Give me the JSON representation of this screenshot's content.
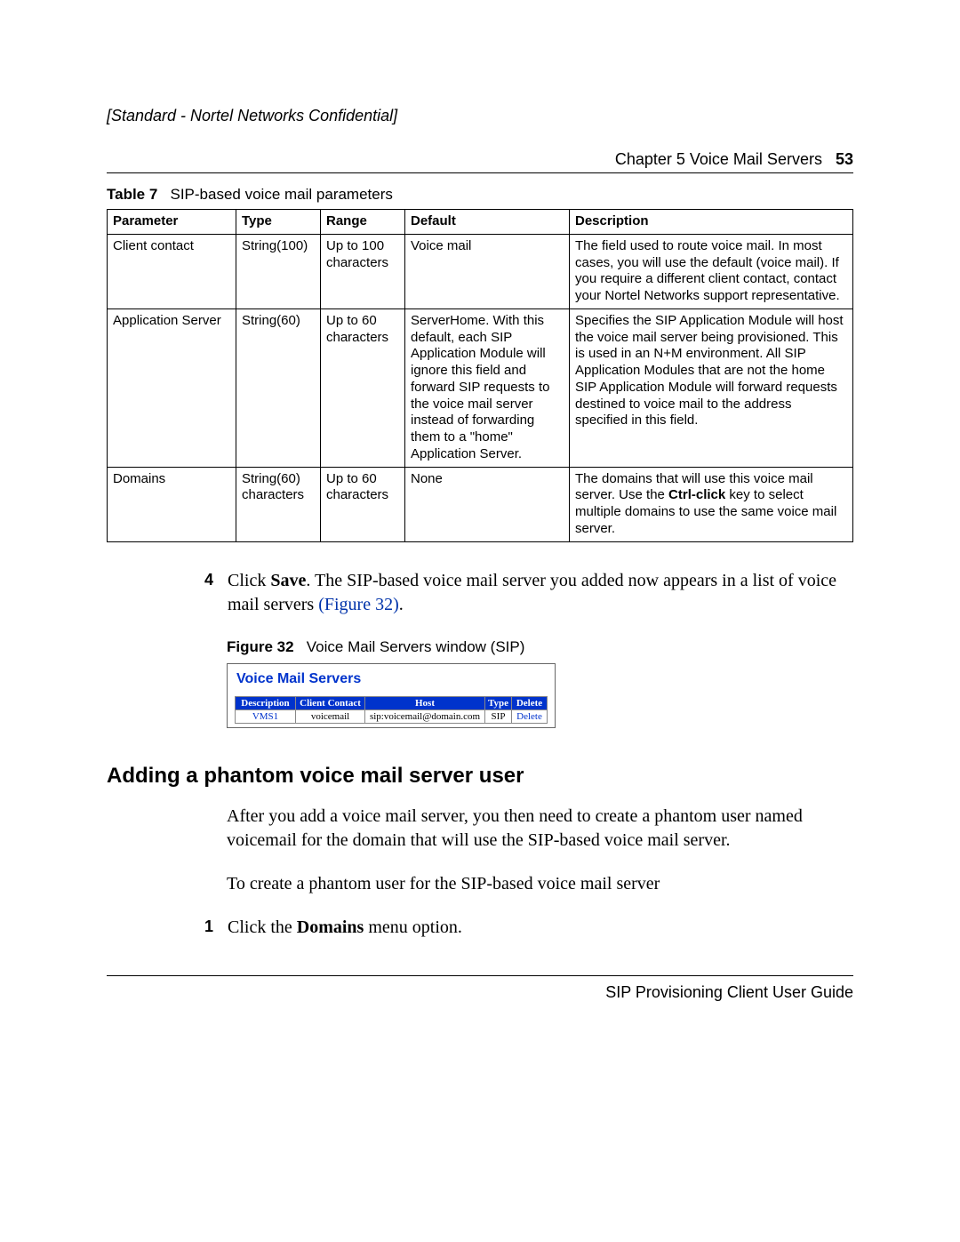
{
  "header": {
    "confidential": "[Standard - Nortel Networks Confidential]",
    "chapter": "Chapter 5  Voice Mail Servers",
    "page_number": "53"
  },
  "table7": {
    "label": "Table 7",
    "caption": "SIP-based voice mail parameters",
    "headers": {
      "parameter": "Parameter",
      "type": "Type",
      "range": "Range",
      "default": "Default",
      "description": "Description"
    },
    "rows": [
      {
        "parameter": "Client contact",
        "type": "String(100)",
        "range": "Up to 100 characters",
        "default": "Voice mail",
        "description": "The field used to route voice mail. In most cases, you will use the default (voice mail). If you require a different client contact, contact your Nortel Networks support representative."
      },
      {
        "parameter": "Application Server",
        "type": "String(60)",
        "range": "Up to 60 characters",
        "default": "ServerHome. With this default, each SIP Application Module will ignore this field and forward SIP requests to the voice mail server instead of forwarding them to a \"home\" Application Server.",
        "description": "Specifies the SIP Application Module will host the voice mail server being provisioned. This is used in an N+M environment. All SIP Application Modules that are not the home SIP Application Module will forward requests destined to voice mail to the address specified in this field."
      },
      {
        "parameter": "Domains",
        "type": "String(60) characters",
        "range": "Up to 60 characters",
        "default": "None",
        "desc_pre": "The domains that will use this voice mail server. Use the ",
        "desc_bold": "Ctrl-click",
        "desc_post": " key to select multiple domains to use the same voice mail server."
      }
    ]
  },
  "step4": {
    "number": "4",
    "text_pre": "Click ",
    "save_word": "Save",
    "text_mid": ". The SIP-based voice mail server you added now appears in a list of voice mail servers ",
    "fig_ref": "(Figure 32)",
    "text_post": "."
  },
  "figure32": {
    "label": "Figure 32",
    "caption": "Voice Mail Servers window (SIP)",
    "panel_title": "Voice Mail Servers",
    "headers": {
      "description": "Description",
      "client_contact": "Client Contact",
      "host": "Host",
      "type": "Type",
      "delete": "Delete"
    },
    "row": {
      "description": "VMS1",
      "client_contact": "voicemail",
      "host": "sip:voicemail@domain.com",
      "type": "SIP",
      "delete": "Delete"
    }
  },
  "section": {
    "heading": "Adding a phantom voice mail server user",
    "para1": "After you add a voice mail server, you then need to create a phantom user named voicemail for the domain that will use the SIP-based voice mail server.",
    "para2": "To create a phantom user for the SIP-based voice mail server"
  },
  "step1": {
    "number": "1",
    "text_pre": "Click the ",
    "bold": "Domains",
    "text_post": " menu option."
  },
  "footer": {
    "guide": "SIP Provisioning Client User Guide"
  }
}
